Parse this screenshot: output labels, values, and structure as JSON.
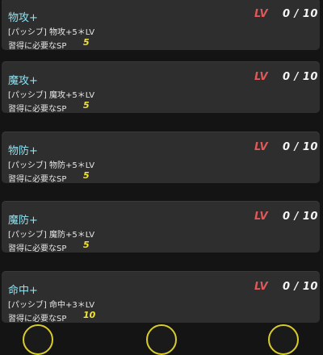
{
  "lv_label": "LV",
  "sp_label": "習得に必要なSP",
  "skills": [
    {
      "name": "物攻+",
      "level": "0 / 10",
      "desc": "[パッシブ] 物攻+5＊LV",
      "sp": "5"
    },
    {
      "name": "魔攻+",
      "level": "0 / 10",
      "desc": "[パッシブ] 魔攻+5＊LV",
      "sp": "5"
    },
    {
      "name": "物防+",
      "level": "0 / 10",
      "desc": "[パッシブ] 物防+5＊LV",
      "sp": "5"
    },
    {
      "name": "魔防+",
      "level": "0 / 10",
      "desc": "[パッシブ] 魔防+5＊LV",
      "sp": "5"
    },
    {
      "name": "命中+",
      "level": "0 / 10",
      "desc": "[パッシブ] 命中+3＊LV",
      "sp": "10"
    }
  ],
  "colors": {
    "skill_name": "#8ee2f2",
    "lv": "#e25858",
    "sp_value": "#f2e33a",
    "card_bg": "#2e2e2e",
    "button_ring": "#d8cc2a"
  }
}
